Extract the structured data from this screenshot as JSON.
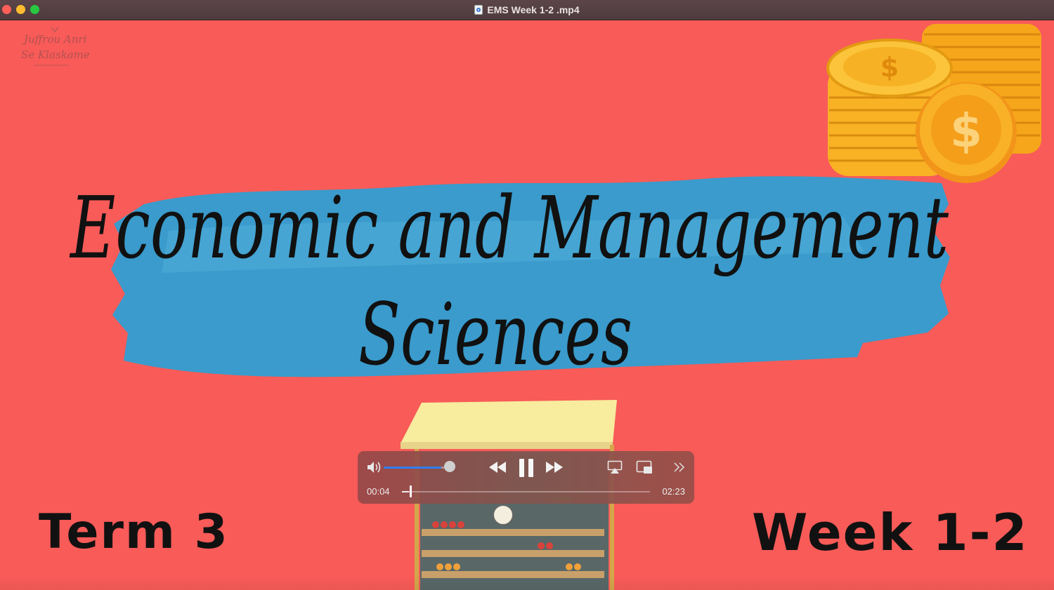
{
  "window": {
    "title": "EMS Week 1-2 .mp4"
  },
  "slide": {
    "title_line1": "Economic and Management",
    "title_line2": "Sciences",
    "term": "Term 3",
    "week": "Week 1-2",
    "background_color": "#f85b58",
    "brush_color": "#2f9fd3"
  },
  "logo": {
    "line1": "Juffrou Anri",
    "line2": "Se Klaskamer"
  },
  "controls": {
    "current_time": "00:04",
    "total_time": "02:23",
    "volume_fraction": 0.85,
    "progress_fraction": 0.028,
    "accent": "#2f7df6"
  },
  "icons": [
    "speaker-icon",
    "rewind-icon",
    "pause-icon",
    "fast-forward-icon",
    "airplay-icon",
    "picture-in-picture-icon",
    "more-chevron-icon",
    "dollar-coin-icon"
  ]
}
